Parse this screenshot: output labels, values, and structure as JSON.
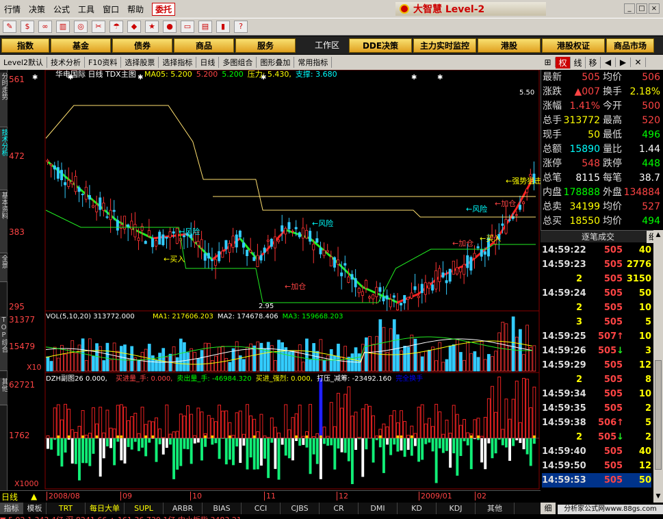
{
  "menu": [
    "行情",
    "决策",
    "公式",
    "工具",
    "窗口",
    "帮助"
  ],
  "weituo": "委托",
  "brand": "大智慧 Level-2",
  "toolbar_icons": [
    "clock-icon",
    "dollar-icon",
    "glasses-icon",
    "bars-icon",
    "binoculars-icon",
    "tools-icon",
    "umbrella-icon",
    "diamond-icon",
    "star-icon",
    "sphere-icon",
    "monitor-icon",
    "panel-icon",
    "books-icon",
    "help-icon"
  ],
  "categories": [
    "指数",
    "基金",
    "债券",
    "商品",
    "服务"
  ],
  "categories_plain": [
    "工作区",
    "DDE决策",
    "主力实时监控",
    "港股",
    "港股权证",
    "商品市场"
  ],
  "subbar": [
    "Level2默认",
    "技术分析",
    "F10资料",
    "选择股票",
    "选择指标",
    "日线",
    "多图组合",
    "图形叠加",
    "常用指标"
  ],
  "subright": [
    "权",
    "线",
    "移"
  ],
  "left_tabs": [
    "分时走势",
    "技术分析",
    "基本资料",
    "全景",
    "TOP综合",
    "其他"
  ],
  "chart": {
    "title": "华电国际 日线 TDX主图",
    "ma_labels": [
      {
        "t": "MA05: 5.200",
        "c": "#ff0"
      },
      {
        "t": "5.200",
        "c": "#f44"
      },
      {
        "t": "5.200",
        "c": "#0f0"
      },
      {
        "t": "压力: 5.430,",
        "c": "#ff0"
      },
      {
        "t": "支撑: 3.680",
        "c": "#0ff"
      }
    ],
    "price_axis": [
      "561",
      "472",
      "383",
      "295"
    ],
    "high_label": "5.50",
    "low_label": "2.95",
    "annotations": [
      {
        "t": "买入",
        "c": "#ff0"
      },
      {
        "t": "风险",
        "c": "#0ff"
      },
      {
        "t": "加仓",
        "c": "#f44"
      },
      {
        "t": "风险",
        "c": "#0ff"
      },
      {
        "t": "加仓",
        "c": "#f44"
      },
      {
        "t": "买入",
        "c": "#ff0"
      },
      {
        "t": "风险",
        "c": "#0ff"
      },
      {
        "t": "加仓",
        "c": "#f44"
      },
      {
        "t": "强势狙击",
        "c": "#ff0"
      }
    ],
    "vol_label": "VOL(5,10,20) 313772.000",
    "vol_ma": [
      {
        "t": "MA1: 217606.203",
        "c": "#ff0"
      },
      {
        "t": "MA2: 174678.406",
        "c": "#fff"
      },
      {
        "t": "MA3: 159668.203",
        "c": "#0f0"
      }
    ],
    "vol_axis": [
      "31377",
      "15479"
    ],
    "vol_unit": "X10",
    "dzh_label": "DZH副图26 0.000,",
    "dzh_items": [
      {
        "t": "买进量_手: 0.000,",
        "c": "#f44"
      },
      {
        "t": "卖出量_手: -46984.320",
        "c": "#0f0"
      },
      {
        "t": "买进_强烈: 0.000,",
        "c": "#ff0"
      },
      {
        "t": "打压_减筹: -23492.160",
        "c": "#fff"
      },
      {
        "t": "完全换手",
        "c": "#00f"
      }
    ],
    "dzh_axis": [
      "62721",
      "1762"
    ],
    "dzh_unit": "X1000",
    "dates": [
      "2008/08",
      "09",
      "10",
      "11",
      "12",
      "2009/01",
      "02"
    ]
  },
  "quote": [
    {
      "k": "最新",
      "v": "505",
      "vc": "#f44",
      "k2": "均价",
      "v2": "506",
      "v2c": "#f44"
    },
    {
      "k": "涨跌",
      "v": "▲007",
      "vc": "#f44",
      "k2": "换手",
      "v2": "2.18%",
      "v2c": "#ff0"
    },
    {
      "k": "涨幅",
      "v": "1.41%",
      "vc": "#f44",
      "k2": "今开",
      "v2": "500",
      "v2c": "#f44"
    },
    {
      "k": "总手",
      "v": "313772",
      "vc": "#ff0",
      "k2": "最高",
      "v2": "520",
      "v2c": "#f44"
    },
    {
      "k": "现手",
      "v": "50",
      "vc": "#ff0",
      "k2": "最低",
      "v2": "496",
      "v2c": "#0f0"
    },
    {
      "k": "总额",
      "v": "15890",
      "vc": "#0ff",
      "k2": "量比",
      "v2": "1.44",
      "v2c": "#fff"
    },
    {
      "k": "涨停",
      "v": "548",
      "vc": "#f44",
      "k2": "跌停",
      "v2": "448",
      "v2c": "#0f0"
    },
    {
      "k": "总笔",
      "v": "8115",
      "vc": "#fff",
      "k2": "每笔",
      "v2": "38.7",
      "v2c": "#fff"
    },
    {
      "k": "内盘",
      "v": "178888",
      "vc": "#0f0",
      "k2": "外盘",
      "v2": "134884",
      "v2c": "#f44"
    },
    {
      "k": "总卖",
      "v": "34199",
      "vc": "#ff0",
      "k2": "均价",
      "v2": "527",
      "v2c": "#f44"
    },
    {
      "k": "总买",
      "v": "18550",
      "vc": "#ff0",
      "k2": "均价",
      "v2": "494",
      "v2c": "#0f0"
    }
  ],
  "ticks_title": "逐笔成交",
  "ticks_btn": "细",
  "ticks": [
    {
      "t": "14:59:22",
      "p": "505",
      "q": "40",
      "a": ""
    },
    {
      "t": "14:59:23",
      "p": "505",
      "q": "2776",
      "a": ""
    },
    {
      "t": "2",
      "p": "505",
      "q": "3150",
      "a": ""
    },
    {
      "t": "14:59:24",
      "p": "505",
      "q": "50",
      "a": ""
    },
    {
      "t": "2",
      "p": "505",
      "q": "10",
      "a": ""
    },
    {
      "t": "3",
      "p": "505",
      "q": "5",
      "a": ""
    },
    {
      "t": "14:59:25",
      "p": "507",
      "q": "10",
      "a": "↑"
    },
    {
      "t": "14:59:26",
      "p": "505",
      "q": "3",
      "a": "↓"
    },
    {
      "t": "14:59:29",
      "p": "505",
      "q": "12",
      "a": ""
    },
    {
      "t": "2",
      "p": "505",
      "q": "8",
      "a": ""
    },
    {
      "t": "14:59:34",
      "p": "505",
      "q": "10",
      "a": ""
    },
    {
      "t": "14:59:35",
      "p": "505",
      "q": "2",
      "a": ""
    },
    {
      "t": "14:59:38",
      "p": "506",
      "q": "5",
      "a": "↑"
    },
    {
      "t": "2",
      "p": "505",
      "q": "2",
      "a": "↓"
    },
    {
      "t": "14:59:40",
      "p": "505",
      "q": "40",
      "a": ""
    },
    {
      "t": "14:59:50",
      "p": "505",
      "q": "12",
      "a": ""
    },
    {
      "t": "14:59:53",
      "p": "505",
      "q": "50",
      "a": ""
    }
  ],
  "bottom_tab": "日线",
  "index_tabs": [
    "指标",
    "模板",
    "TRT",
    "每日大单",
    "SUPL",
    "ARBR",
    "BIAS",
    "CCI",
    "CJBS",
    "CR",
    "DMI",
    "KD",
    "KDJ",
    "其他"
  ],
  "bottom_right": "细",
  "watermark": "分析家公式网www.88gs.com",
  "status": "▼ 5.02   1.343.4亿 深   8241.66   ▲ 161.36   730.1亿 中小板指   3483.21"
}
